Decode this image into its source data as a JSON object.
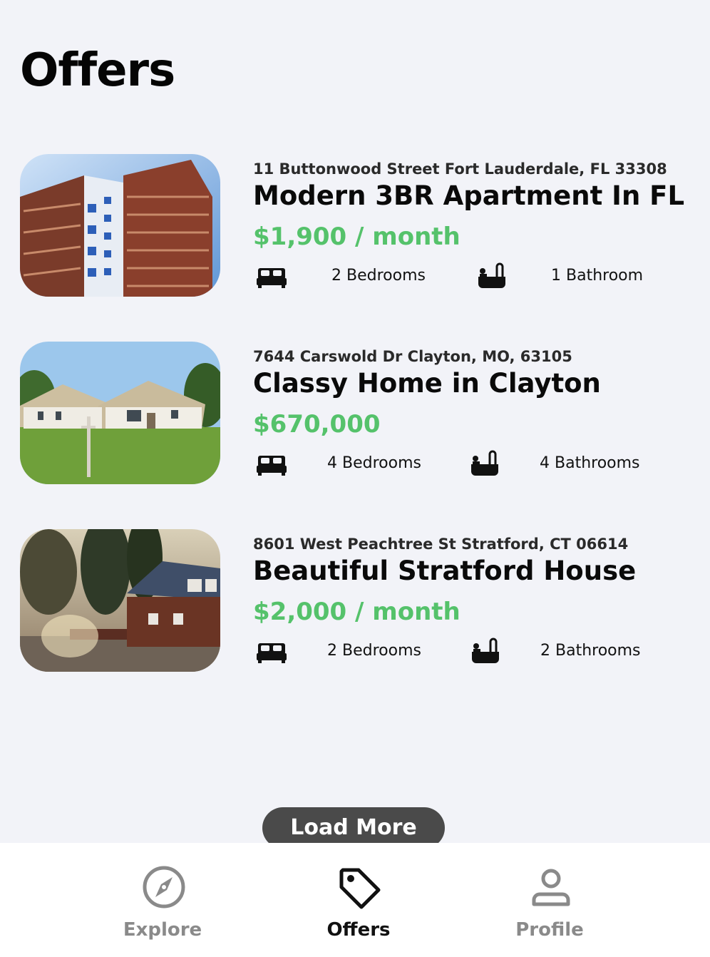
{
  "page": {
    "title": "Offers"
  },
  "listings": [
    {
      "address": "11 Buttonwood Street Fort Lauderdale, FL 33308",
      "name": "Modern 3BR Apartment In FL",
      "price": "$1,900 / month",
      "bedrooms": "2 Bedrooms",
      "bathrooms": "1 Bathroom",
      "image": "apartment-tower-photo"
    },
    {
      "address": "7644 Carswold Dr Clayton, MO, 63105",
      "name": "Classy Home in Clayton",
      "price": "$670,000",
      "bedrooms": "4 Bedrooms",
      "bathrooms": "4 Bathrooms",
      "image": "suburban-house-lawn-photo"
    },
    {
      "address": "8601 West Peachtree St Stratford, CT 06614",
      "name": "Beautiful Stratford House",
      "price": "$2,000 / month",
      "bedrooms": "2 Bedrooms",
      "bathrooms": "2 Bathrooms",
      "image": "house-in-trees-photo"
    }
  ],
  "load_more": {
    "label": "Load More"
  },
  "tabs": [
    {
      "label": "Explore",
      "icon": "compass-icon",
      "active": false
    },
    {
      "label": "Offers",
      "icon": "tag-icon",
      "active": true
    },
    {
      "label": "Profile",
      "icon": "person-icon",
      "active": false
    }
  ],
  "colors": {
    "background": "#f2f3f8",
    "price_green": "#55c26b",
    "button_dark": "#4a4a4a",
    "tab_inactive": "#8a8a8a",
    "tab_active": "#111111"
  }
}
